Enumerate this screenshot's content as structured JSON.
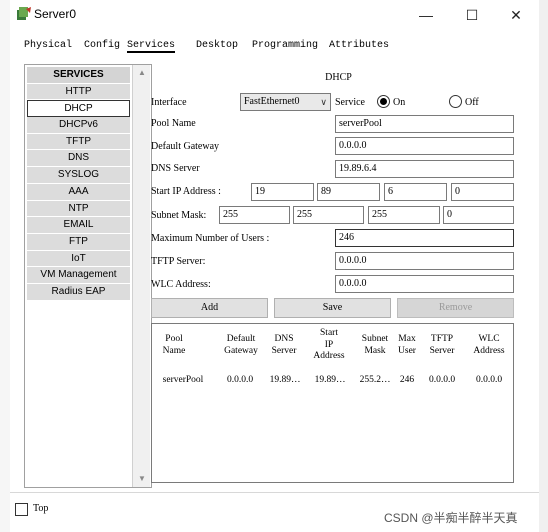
{
  "window": {
    "title": "Server0",
    "minimize": "—",
    "maximize": "☐",
    "close": "✕"
  },
  "tabs": [
    "Physical",
    "Config",
    "Services",
    "Desktop",
    "Programming",
    "Attributes"
  ],
  "active_tab": "Services",
  "services": {
    "header": "SERVICES",
    "items": [
      "HTTP",
      "DHCP",
      "DHCPv6",
      "TFTP",
      "DNS",
      "SYSLOG",
      "AAA",
      "NTP",
      "EMAIL",
      "FTP",
      "IoT",
      "VM Management",
      "Radius EAP"
    ],
    "selected": "DHCP"
  },
  "dhcp": {
    "heading": "DHCP",
    "interface_label": "Interface",
    "interface_value": "FastEthernet0",
    "service_label": "Service",
    "on_label": "On",
    "off_label": "Off",
    "service_state": "On",
    "pool_name_label": "Pool Name",
    "pool_name": "serverPool",
    "default_gateway_label": "Default Gateway",
    "default_gateway": "0.0.0.0",
    "dns_server_label": "DNS Server",
    "dns_server": "19.89.6.4",
    "start_ip_label": "Start IP Address :",
    "start_ip": [
      "19",
      "89",
      "6",
      "0"
    ],
    "subnet_mask_label": "Subnet Mask:",
    "subnet_mask": [
      "255",
      "255",
      "255",
      "0"
    ],
    "max_users_label": "Maximum Number of Users :",
    "max_users": "246",
    "tftp_server_label": "TFTP Server:",
    "tftp_server": "0.0.0.0",
    "wlc_address_label": "WLC Address:",
    "wlc_address": "0.0.0.0",
    "buttons": {
      "add": "Add",
      "save": "Save",
      "remove": "Remove"
    },
    "table": {
      "headers": [
        "Pool\nName",
        "Default\nGateway",
        "DNS\nServer",
        "Start\nIP\nAddress",
        "Subnet\nMask",
        "Max\nUser",
        "TFTP\nServer",
        "WLC\nAddress"
      ],
      "rows": [
        [
          "serverPool",
          "0.0.0.0",
          "19.89…",
          "19.89…",
          "255.2…",
          "246",
          "0.0.0.0",
          "0.0.0.0"
        ]
      ]
    }
  },
  "bottom": {
    "top_label": "Top",
    "top_checked": false
  },
  "watermark": "CSDN @半痴半醉半天真",
  "colors": {
    "service_bg": "#dcdcdc",
    "selected_bg": "#ffffff",
    "disabled_text": "#9a9a9a"
  }
}
